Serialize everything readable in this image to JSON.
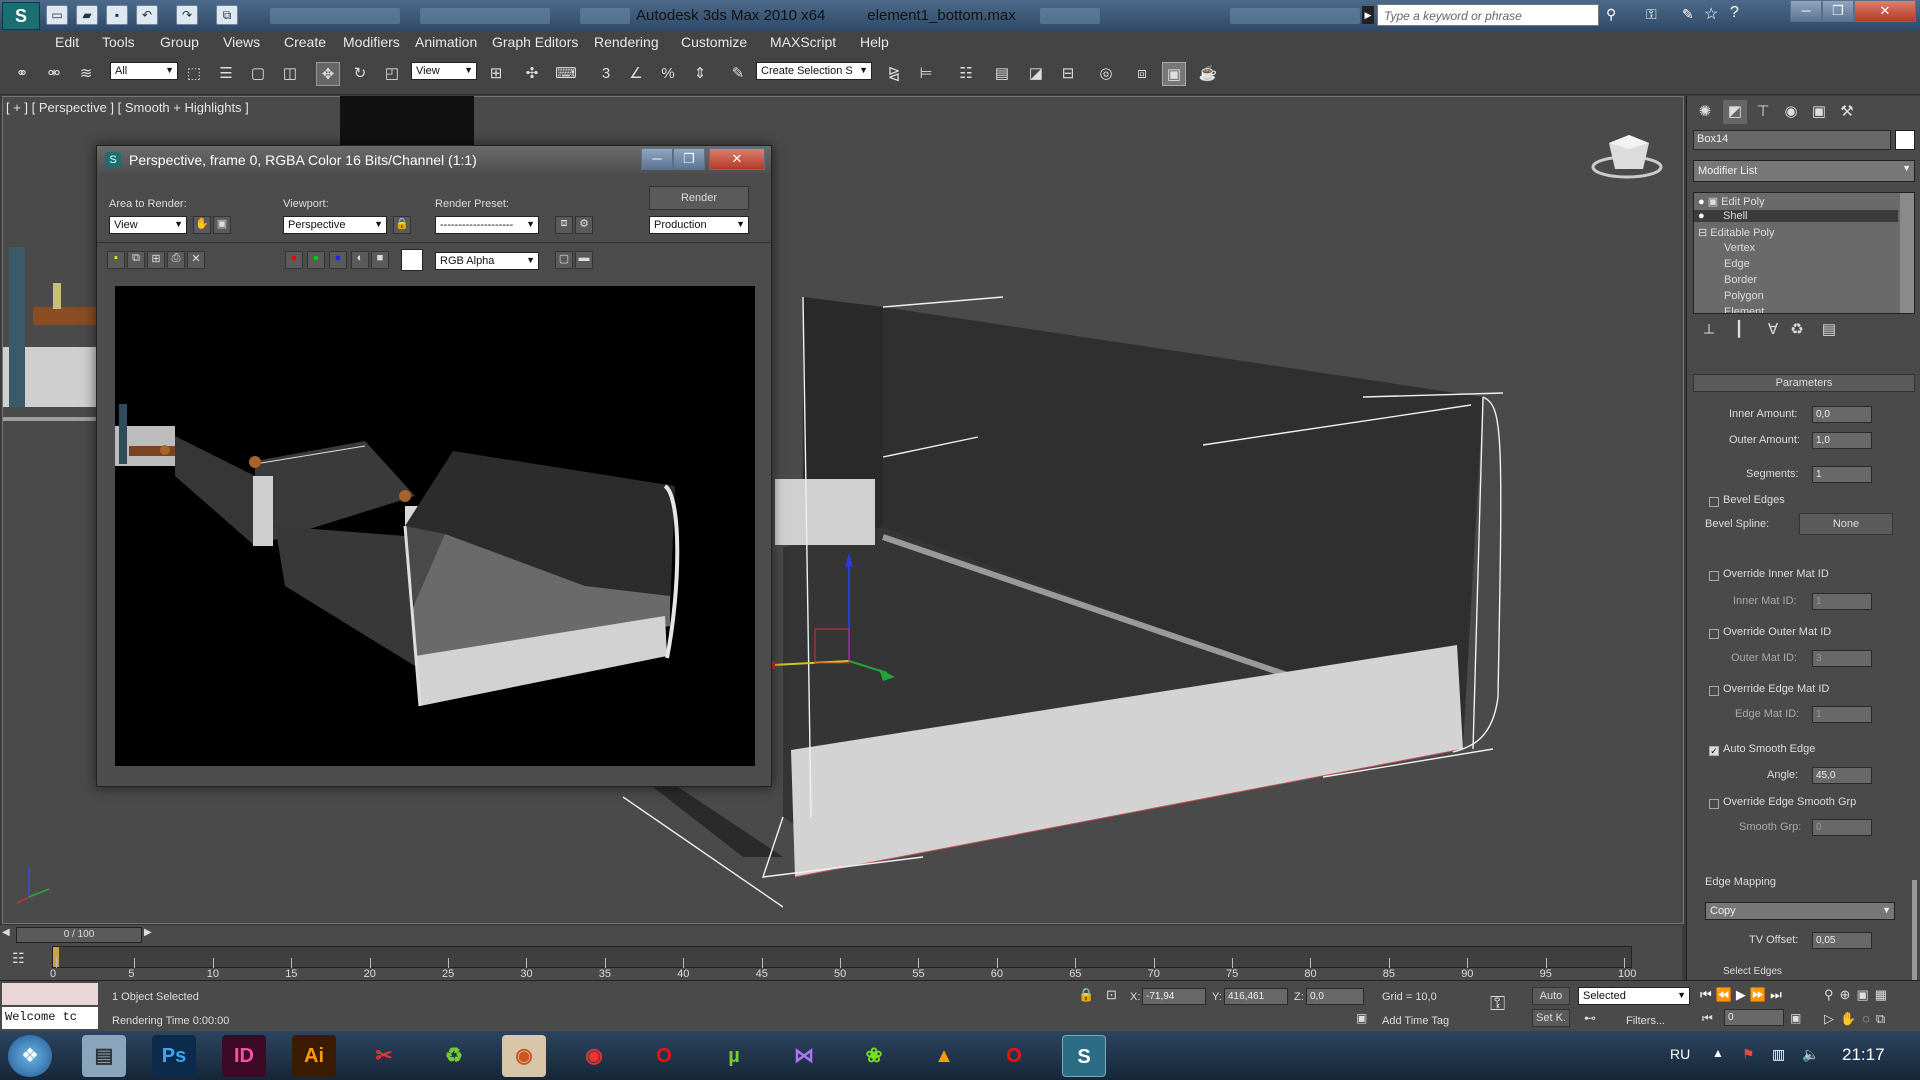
{
  "app": {
    "title": "Autodesk 3ds Max  2010 x64",
    "file": "element1_bottom.max",
    "search_placeholder": "Type a keyword or phrase"
  },
  "menu": [
    "Edit",
    "Tools",
    "Group",
    "Views",
    "Create",
    "Modifiers",
    "Animation",
    "Graph Editors",
    "Rendering",
    "Customize",
    "MAXScript",
    "Help"
  ],
  "toolbar": {
    "selection_filter": "All",
    "ref_coord": "View",
    "named_selection": "Create Selection S"
  },
  "viewport": {
    "label": "[ + ] [ Perspective ] [ Smooth + Highlights ]"
  },
  "render_window": {
    "title": "Perspective, frame 0, RGBA Color 16 Bits/Channel (1:1)",
    "area_label": "Area to Render:",
    "area_value": "View",
    "viewport_label": "Viewport:",
    "viewport_value": "Perspective",
    "preset_label": "Render Preset:",
    "preset_value": "--------------------",
    "render_button": "Render",
    "production_value": "Production",
    "channel_value": "RGB Alpha"
  },
  "command_panel": {
    "object_name": "Box14",
    "modifier_list": "Modifier List",
    "stack": [
      "Edit Poly",
      "Shell",
      "Editable Poly",
      "Vertex",
      "Edge",
      "Border",
      "Polygon",
      "Element"
    ],
    "parameters_title": "Parameters",
    "inner_amount_label": "Inner Amount:",
    "inner_amount": "0,0",
    "outer_amount_label": "Outer Amount:",
    "outer_amount": "1,0",
    "segments_label": "Segments:",
    "segments": "1",
    "bevel_edges": "Bevel Edges",
    "bevel_spline_label": "Bevel Spline:",
    "bevel_spline": "None",
    "override_inner": "Override Inner Mat ID",
    "inner_mat_label": "Inner Mat ID:",
    "inner_mat": "1",
    "override_outer": "Override Outer Mat ID",
    "outer_mat_label": "Outer Mat ID:",
    "outer_mat": "3",
    "override_edge": "Override Edge Mat ID",
    "edge_mat_label": "Edge Mat ID:",
    "edge_mat": "1",
    "auto_smooth": "Auto Smooth Edge",
    "angle_label": "Angle:",
    "angle": "45,0",
    "override_smooth": "Override Edge Smooth Grp",
    "smooth_grp_label": "Smooth Grp:",
    "smooth_grp": "0",
    "edge_mapping_label": "Edge Mapping",
    "edge_mapping": "Copy",
    "tv_offset_label": "TV Offset:",
    "tv_offset": "0,05",
    "select_edges": "Select Edges"
  },
  "timeline": {
    "frame": "0 / 100",
    "ticks": [
      "0",
      "5",
      "10",
      "15",
      "20",
      "25",
      "30",
      "35",
      "40",
      "45",
      "50",
      "55",
      "60",
      "65",
      "70",
      "75",
      "80",
      "85",
      "90",
      "95",
      "100"
    ]
  },
  "status": {
    "selected": "1 Object Selected",
    "rendering_time": "Rendering Time  0:00:00",
    "welcome": "Welcome tc",
    "x_label": "X:",
    "x": "-71,94",
    "y_label": "Y:",
    "y": "416,461",
    "z_label": "Z:",
    "z": "0,0",
    "grid": "Grid = 10,0",
    "add_time_tag": "Add Time Tag",
    "auto": "Auto",
    "set_key": "Set K.",
    "selected_dd": "Selected",
    "filters": "Filters...",
    "frame_field": "0"
  },
  "taskbar": {
    "lang": "RU",
    "time": "21:17",
    "apps": [
      "Ps",
      "ID",
      "Ai"
    ]
  }
}
